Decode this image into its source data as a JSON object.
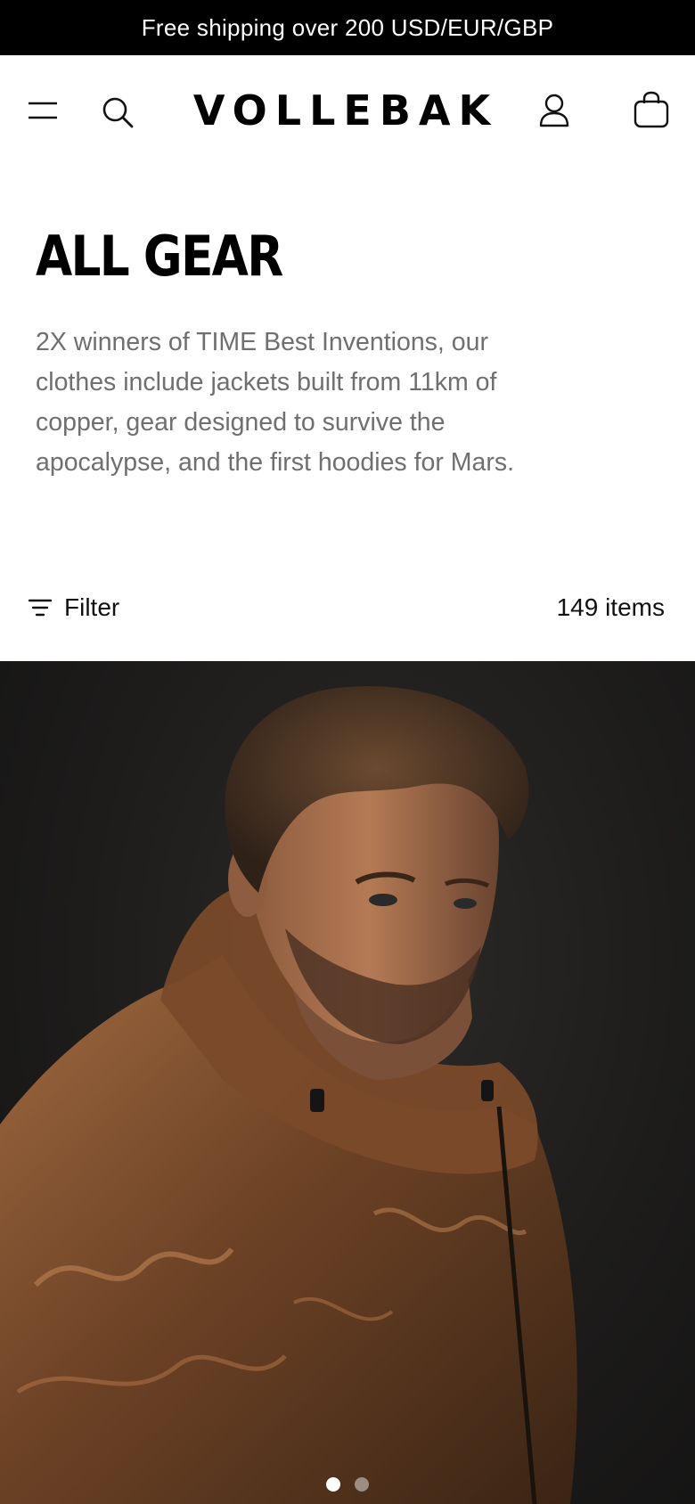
{
  "announcement": {
    "text": "Free shipping over 200 USD/EUR/GBP"
  },
  "header": {
    "logo_text": "VOLLEBAK",
    "icons": {
      "menu": "menu-icon",
      "search": "search-icon",
      "account": "user-icon",
      "cart": "shopping-bag-icon"
    }
  },
  "collection": {
    "title": "ALL GEAR",
    "description": "2X winners of TIME Best Inventions, our clothes include jackets built from 11km of copper, gear designed to survive the apocalypse, and the first hoodies for Mars."
  },
  "filter": {
    "label": "Filter",
    "count_label": "149 items",
    "icon": "filter-lines-icon"
  },
  "hero": {
    "image_alt": "",
    "carousel": {
      "total": 2,
      "active": 1
    }
  },
  "colors": {
    "announcement_bg": "#000000",
    "text_primary": "#111111",
    "text_secondary": "#6f6f6f",
    "hero_bg": "#1d1c1b",
    "jacket_copper": "#8a5632"
  }
}
